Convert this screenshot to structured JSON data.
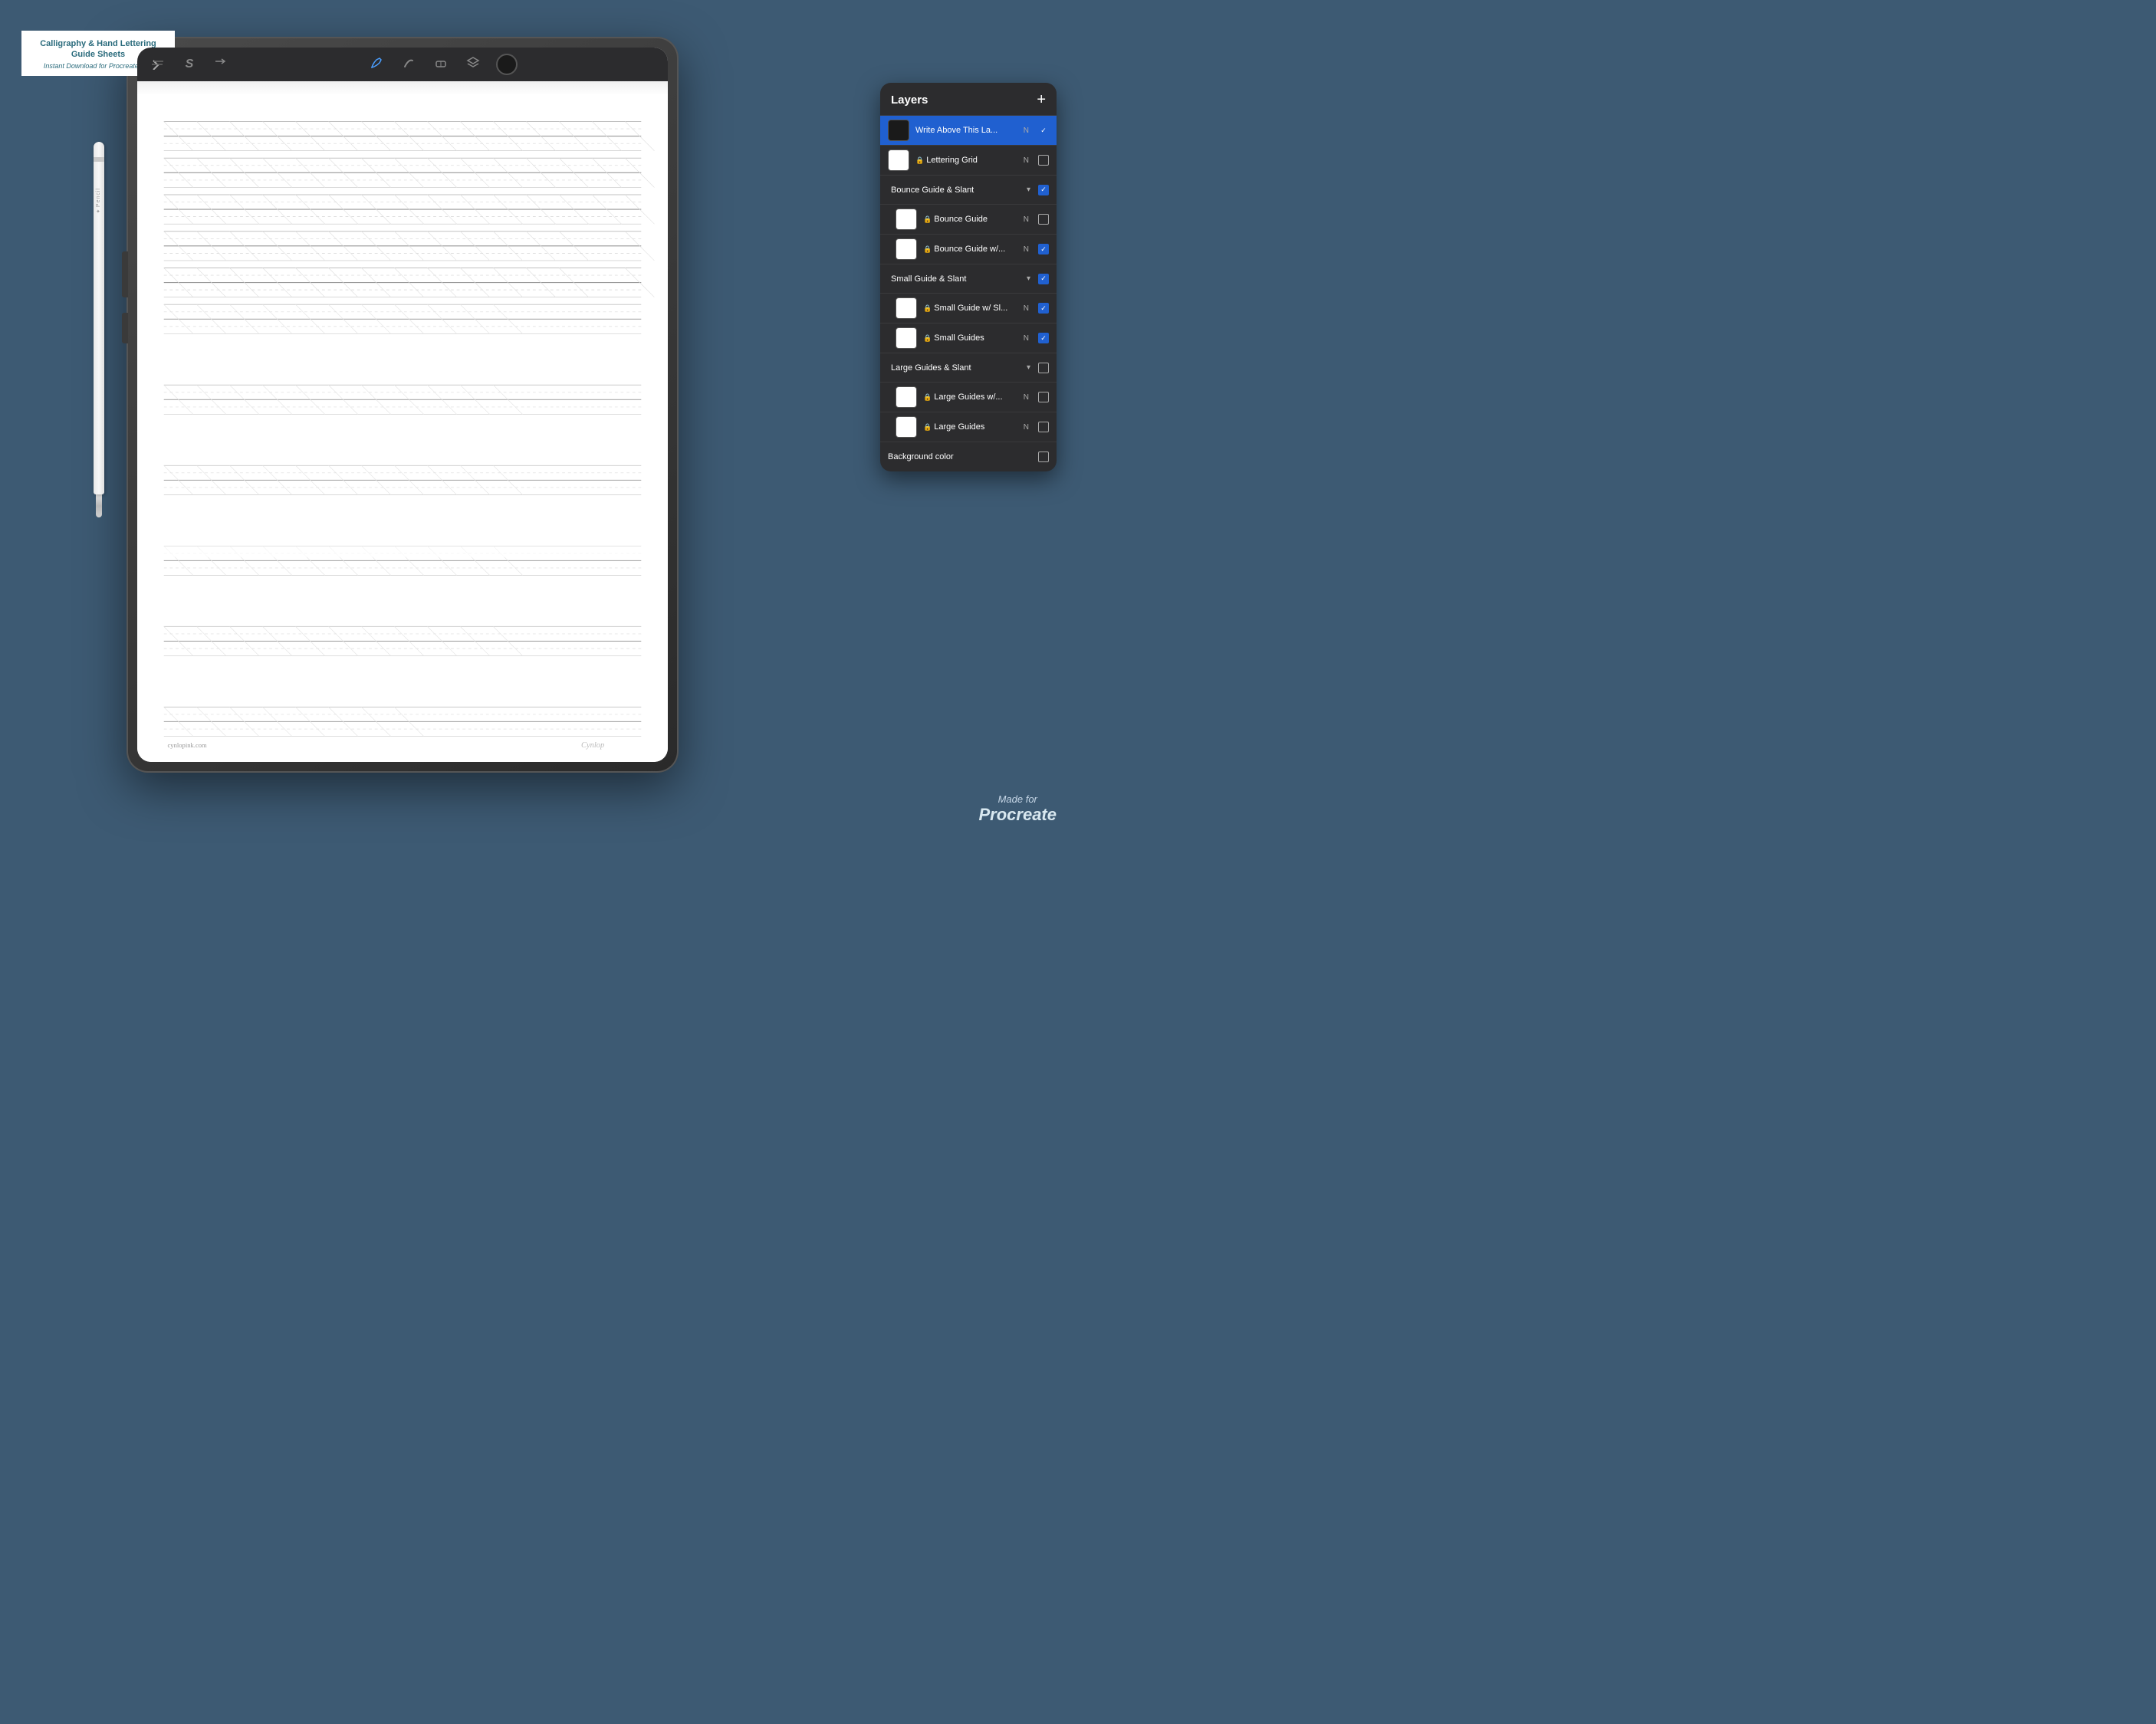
{
  "branding": {
    "title": "Calligraphy & Hand Lettering Guide Sheets",
    "subtitle": "Instant Download for Procreate App"
  },
  "toolbar": {
    "icons": [
      "✏️",
      "S",
      "↗",
      "🖌",
      "✒",
      "🖼",
      "⬤"
    ],
    "active_index": 3
  },
  "layers_panel": {
    "title": "Layers",
    "add_button": "+",
    "layers": [
      {
        "name": "Write Above This La...",
        "thumb": "dark",
        "mode": "N",
        "checked": "checked-blue",
        "active": true
      },
      {
        "name": "🔒 Lettering Grid",
        "thumb": "white",
        "mode": "N",
        "checked": "unchecked"
      },
      {
        "name": "Bounce Guide & Slant",
        "thumb": null,
        "mode": "▾",
        "checked": "checked-blue",
        "group": true
      },
      {
        "name": "🔒 Bounce Guide",
        "thumb": "white",
        "mode": "N",
        "checked": "unchecked"
      },
      {
        "name": "🔒 Bounce Guide w/...",
        "thumb": "white",
        "mode": "N",
        "checked": "checked-blue"
      },
      {
        "name": "Small Guide & Slant",
        "thumb": null,
        "mode": "▾",
        "checked": "checked-blue",
        "group": true
      },
      {
        "name": "🔒 Small Guide w/ Sl...",
        "thumb": "white",
        "mode": "N",
        "checked": "checked-blue"
      },
      {
        "name": "🔒 Small Guides",
        "thumb": "white",
        "mode": "N",
        "checked": "checked-blue"
      },
      {
        "name": "Large Guides & Slant",
        "thumb": null,
        "mode": "▾",
        "checked": "unchecked",
        "group": true
      },
      {
        "name": "🔒 Large Guides w/...",
        "thumb": "white",
        "mode": "N",
        "checked": "unchecked"
      },
      {
        "name": "🔒 Large Guides",
        "thumb": "white",
        "mode": "N",
        "checked": "unchecked"
      },
      {
        "name": "Background color",
        "thumb": null,
        "mode": "",
        "checked": "unchecked",
        "bg_item": true
      }
    ]
  },
  "footer": {
    "left": "cynlopink.com",
    "brand": "Cynlop"
  },
  "made_for": {
    "line1": "Made for",
    "line2": "Procreate"
  }
}
